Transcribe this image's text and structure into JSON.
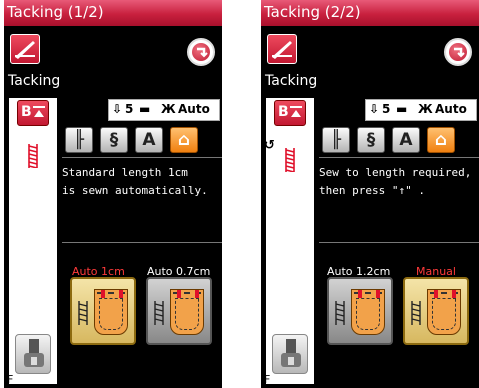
{
  "panels": [
    {
      "title": "Tacking (1/2)",
      "heading": "Tacking",
      "settings": {
        "length": "5",
        "width": "Auto"
      },
      "description": [
        "Standard length 1cm",
        "is sewn automatically."
      ],
      "options": [
        {
          "label": "Auto 1cm",
          "selected": true
        },
        {
          "label": "Auto 0.7cm",
          "selected": false
        }
      ],
      "presser_foot": "F"
    },
    {
      "title": "Tacking (2/2)",
      "heading": "Tacking",
      "settings": {
        "length": "5",
        "width": "Auto"
      },
      "description": [
        "Sew to length required,",
        "then press \"↑\" ."
      ],
      "options": [
        {
          "label": "Auto 1.2cm",
          "selected": false
        },
        {
          "label": "Manual",
          "selected": true
        }
      ],
      "presser_foot": "F"
    }
  ],
  "colors": {
    "accent": "#d22a44",
    "selected_label": "#ff3a3a",
    "unselected_label": "#ffffff",
    "active_mode": "#f59020"
  },
  "icons": {
    "tool": "pencil-icon",
    "back": "return-icon",
    "pattern": "bartack-pattern-icon",
    "presser_foot": "presser-foot-icon"
  }
}
